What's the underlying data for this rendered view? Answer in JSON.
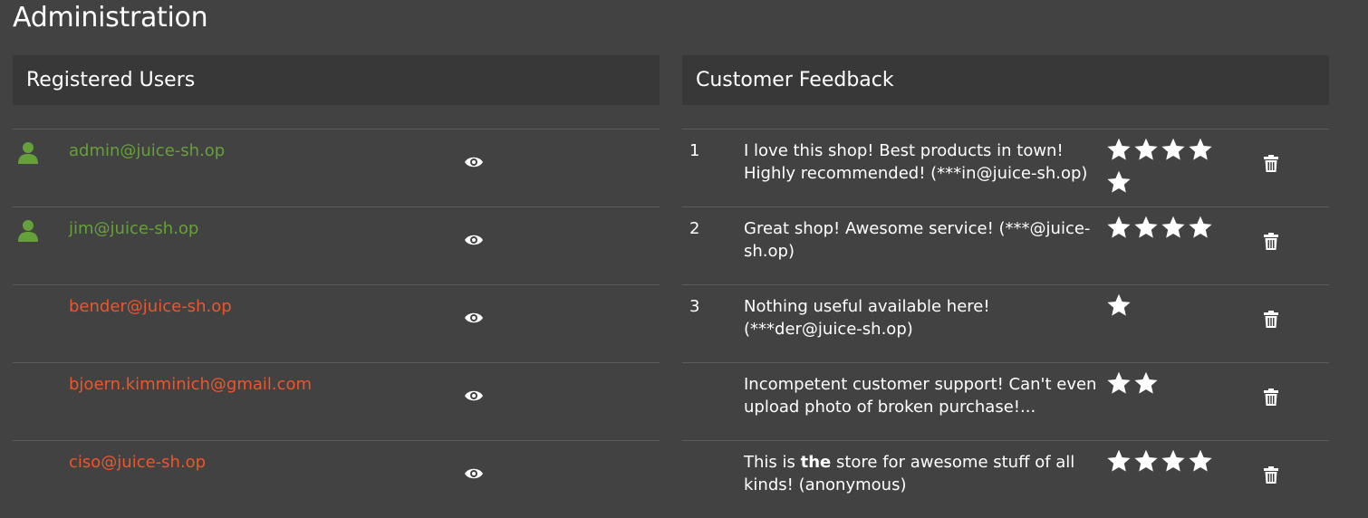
{
  "page": {
    "title": "Administration"
  },
  "users_panel": {
    "title": "Registered Users",
    "users": [
      {
        "email": "admin@juice-sh.op",
        "status": "good",
        "icon": "user-icon"
      },
      {
        "email": "jim@juice-sh.op",
        "status": "good",
        "icon": "user-icon"
      },
      {
        "email": "bender@juice-sh.op",
        "status": "bad",
        "icon": ""
      },
      {
        "email": "bjoern.kimminich@gmail.com",
        "status": "bad",
        "icon": ""
      },
      {
        "email": "ciso@juice-sh.op",
        "status": "bad",
        "icon": ""
      }
    ]
  },
  "feedback_panel": {
    "title": "Customer Feedback",
    "items": [
      {
        "id": "1",
        "text_before": "I love this shop! Best products in town! Highly recommended! (***in@juice-sh.op)",
        "text_bold": "",
        "text_after": "",
        "rating": 5
      },
      {
        "id": "2",
        "text_before": "Great shop! Awesome service! (***@juice-sh.op)",
        "text_bold": "",
        "text_after": "",
        "rating": 4
      },
      {
        "id": "3",
        "text_before": "Nothing useful available here! (***der@juice-sh.op)",
        "text_bold": "",
        "text_after": "",
        "rating": 1
      },
      {
        "id": "",
        "text_before": "Incompetent customer support! Can't even upload photo of broken purchase!...",
        "text_bold": "",
        "text_after": "",
        "rating": 2
      },
      {
        "id": "",
        "text_before": "This is ",
        "text_bold": "the",
        "text_after": " store for awesome stuff of all kinds! (anonymous)",
        "rating": 4
      }
    ]
  },
  "colors": {
    "background": "#424242",
    "header_bg": "#383838",
    "good_user": "#66a03a",
    "bad_user": "#f0552a"
  },
  "icons": {
    "view": "eye-icon",
    "delete": "trash-icon",
    "rating": "star-icon",
    "user": "user-icon"
  }
}
